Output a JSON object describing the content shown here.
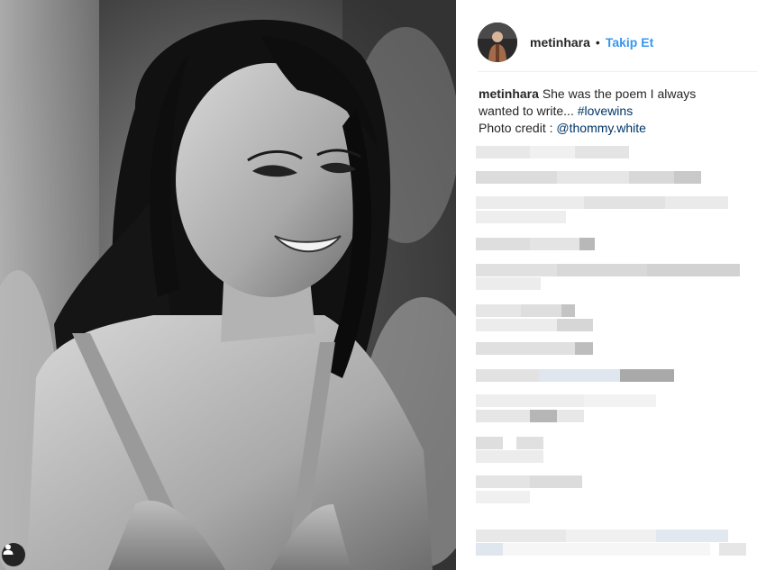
{
  "post": {
    "username": "metinhara",
    "separator": "•",
    "follow_label": "Takip Et"
  },
  "caption": {
    "username": "metinhara",
    "text_line1": "She was the poem I always",
    "text_line2": "wanted to write... ",
    "hashtag": "#lovewins",
    "credit_prefix": "Photo credit : ",
    "credit_mention": "@thommy.white"
  },
  "icons": {
    "tag": "person-tag-icon"
  },
  "colors": {
    "accent": "#3897f0",
    "link": "#003569",
    "text": "#262626"
  }
}
